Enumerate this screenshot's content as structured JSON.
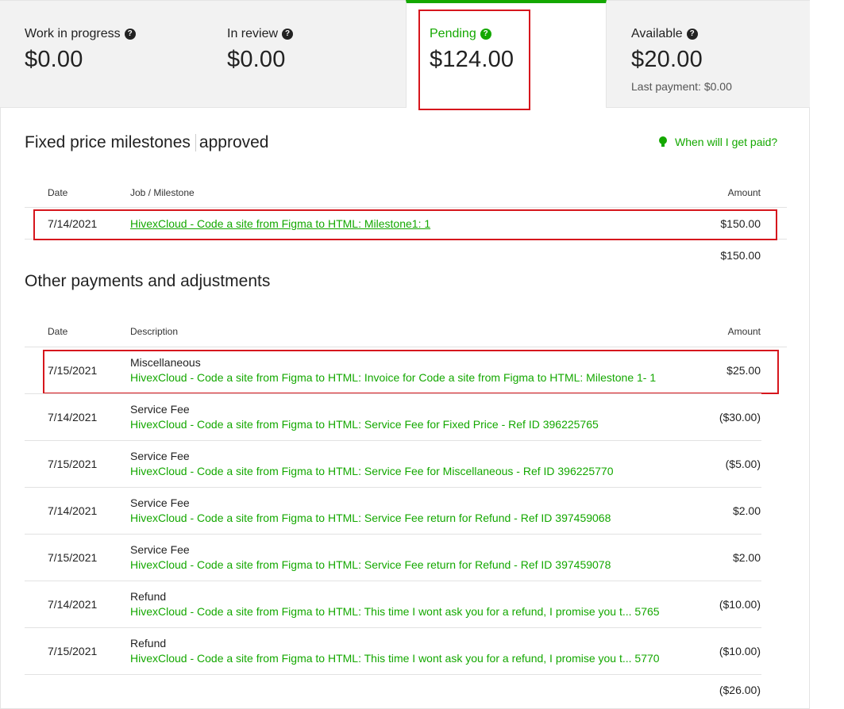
{
  "tabs": [
    {
      "label": "Work in progress",
      "amount": "$0.00"
    },
    {
      "label": "In review",
      "amount": "$0.00"
    },
    {
      "label": "Pending",
      "amount": "$124.00"
    },
    {
      "label": "Available",
      "amount": "$20.00",
      "sub": "Last payment: $0.00"
    }
  ],
  "help_icon_glyph": "?",
  "fixed": {
    "title_left": "Fixed price milestones",
    "title_right": "approved",
    "help_link": "When will I get paid?",
    "headers": {
      "date": "Date",
      "job": "Job / Milestone",
      "amount": "Amount"
    },
    "rows": [
      {
        "date": "7/14/2021",
        "job": "HivexCloud - Code a site from Figma to HTML: Milestone1: 1",
        "amount": "$150.00"
      }
    ],
    "total": "$150.00"
  },
  "other": {
    "title": "Other payments and adjustments",
    "headers": {
      "date": "Date",
      "desc": "Description",
      "amount": "Amount"
    },
    "rows": [
      {
        "date": "7/15/2021",
        "type": "Miscellaneous",
        "desc": "HivexCloud - Code a site from Figma to HTML: Invoice for Code a site from Figma to HTML: Milestone 1- 1",
        "amount": "$25.00"
      },
      {
        "date": "7/14/2021",
        "type": "Service Fee",
        "desc": "HivexCloud - Code a site from Figma to HTML: Service Fee for Fixed Price - Ref ID 396225765",
        "amount": "($30.00)"
      },
      {
        "date": "7/15/2021",
        "type": "Service Fee",
        "desc": "HivexCloud - Code a site from Figma to HTML: Service Fee for Miscellaneous - Ref ID 396225770",
        "amount": "($5.00)"
      },
      {
        "date": "7/14/2021",
        "type": "Service Fee",
        "desc": "HivexCloud - Code a site from Figma to HTML: Service Fee return for Refund - Ref ID 397459068",
        "amount": "$2.00"
      },
      {
        "date": "7/15/2021",
        "type": "Service Fee",
        "desc": "HivexCloud - Code a site from Figma to HTML: Service Fee return for Refund - Ref ID 397459078",
        "amount": "$2.00"
      },
      {
        "date": "7/14/2021",
        "type": "Refund",
        "desc": "HivexCloud - Code a site from Figma to HTML: This time I wont ask you for a refund, I promise you t... 5765",
        "amount": "($10.00)"
      },
      {
        "date": "7/15/2021",
        "type": "Refund",
        "desc": "HivexCloud - Code a site from Figma to HTML: This time I wont ask you for a refund, I promise you t... 5770",
        "amount": "($10.00)"
      }
    ],
    "total": "($26.00)"
  },
  "colors": {
    "accent": "#14a800",
    "highlight": "#d6161d",
    "tab_bg": "#f2f2f2"
  }
}
